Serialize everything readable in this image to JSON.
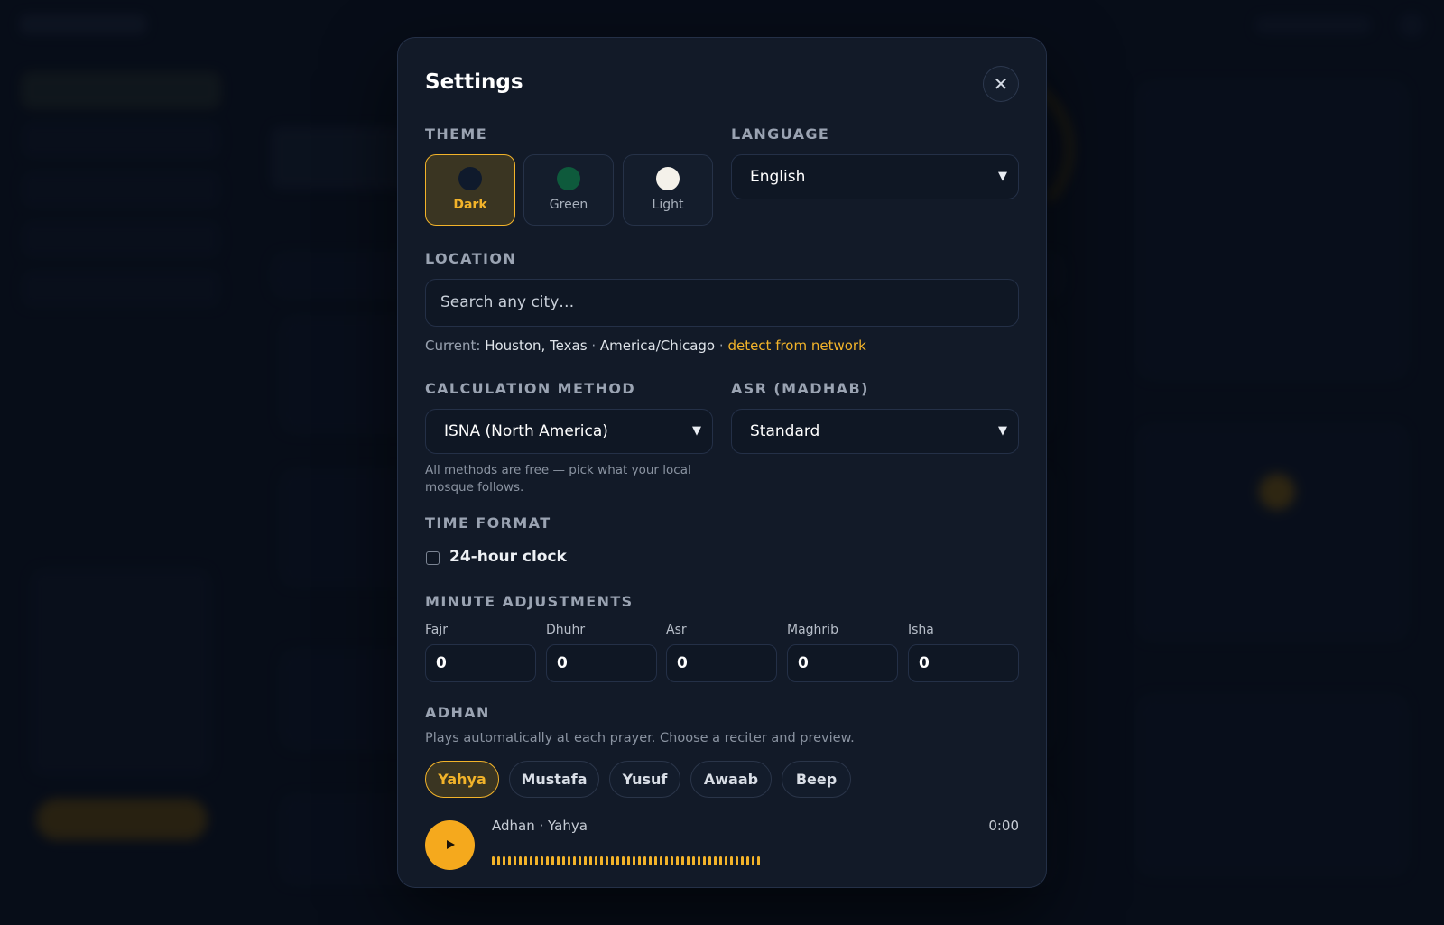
{
  "settings": {
    "title": "Settings",
    "close_symbol": "✕",
    "theme": {
      "label": "THEME",
      "options": [
        {
          "name": "Dark",
          "swatch": "#0f1a2c",
          "active": true
        },
        {
          "name": "Green",
          "swatch": "#0e5a3c",
          "active": false
        },
        {
          "name": "Light",
          "swatch": "#f4f1ea",
          "active": false
        }
      ]
    },
    "language": {
      "label": "LANGUAGE",
      "selected": "English"
    },
    "location": {
      "label": "LOCATION",
      "placeholder": "Search any city…",
      "current_prefix": "Current:",
      "current_city": "Houston, Texas",
      "separator": "·",
      "timezone": "America/Chicago",
      "detect_link": "detect from network"
    },
    "calculation_method": {
      "label": "CALCULATION METHOD",
      "selected": "ISNA (North America)",
      "hint": "All methods are free — pick what your local mosque follows."
    },
    "asr": {
      "label": "ASR (MADHAB)",
      "selected": "Standard"
    },
    "time_format": {
      "label": "TIME FORMAT",
      "checkbox_label": "24-hour clock",
      "checked": false
    },
    "minute_adjustments": {
      "label": "MINUTE ADJUSTMENTS",
      "prayers": [
        {
          "name": "Fajr",
          "value": "0"
        },
        {
          "name": "Dhuhr",
          "value": "0"
        },
        {
          "name": "Asr",
          "value": "0"
        },
        {
          "name": "Maghrib",
          "value": "0"
        },
        {
          "name": "Isha",
          "value": "0"
        }
      ]
    },
    "adhan": {
      "label": "ADHAN",
      "description": "Plays automatically at each prayer. Choose a reciter and preview.",
      "reciters": [
        {
          "name": "Yahya",
          "active": true
        },
        {
          "name": "Mustafa",
          "active": false
        },
        {
          "name": "Yusuf",
          "active": false
        },
        {
          "name": "Awaab",
          "active": false
        },
        {
          "name": "Beep",
          "active": false
        }
      ],
      "player": {
        "title": "Adhan · Yahya",
        "time": "0:00"
      }
    }
  },
  "colors": {
    "accent": "#f2b32a",
    "modal_bg": "#121a28",
    "page_bg": "#0a1220"
  }
}
